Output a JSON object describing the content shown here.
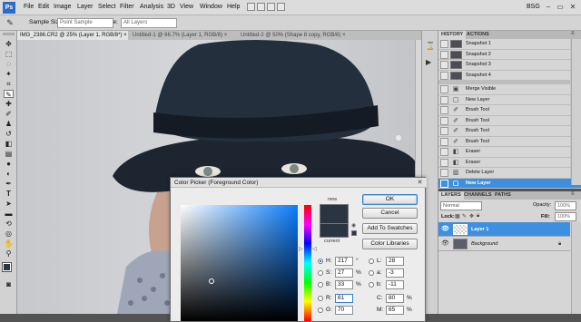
{
  "menubar": {
    "app_logo": "Ps",
    "items": [
      "File",
      "Edit",
      "Image",
      "Layer",
      "Select",
      "Filter",
      "Analysis",
      "3D",
      "View",
      "Window",
      "Help"
    ],
    "workspace": "BSG",
    "win_controls": [
      "–",
      "▭",
      "✕"
    ]
  },
  "options_bar": {
    "sample_size_label": "Sample Size:",
    "sample_size_value": "Point Sample",
    "sample_label": "Sample:",
    "sample_value": "All Layers"
  },
  "doc_tabs": [
    {
      "label": "IMG_2386.CR2 @ 25% (Layer 1, RGB/8*) ×",
      "active": true
    },
    {
      "label": "Untitled-1 @ 66.7% (Layer 1, RGB/8) ×",
      "active": false
    },
    {
      "label": "Untitled-2 @ 50% (Shape 8 copy, RGB/8) ×",
      "active": false
    }
  ],
  "history": {
    "tabs": [
      "HISTORY",
      "ACTIONS"
    ],
    "items": [
      {
        "label": "Snapshot 1",
        "kind": "snapshot"
      },
      {
        "label": "Snapshot 2",
        "kind": "snapshot"
      },
      {
        "label": "Snapshot 3",
        "kind": "snapshot"
      },
      {
        "label": "Snapshot 4",
        "kind": "snapshot"
      },
      {
        "label": "Merge Visible",
        "kind": "step"
      },
      {
        "label": "New Layer",
        "kind": "step"
      },
      {
        "label": "Brush Tool",
        "kind": "step"
      },
      {
        "label": "Brush Tool",
        "kind": "step"
      },
      {
        "label": "Brush Tool",
        "kind": "step"
      },
      {
        "label": "Brush Tool",
        "kind": "step"
      },
      {
        "label": "Eraser",
        "kind": "step"
      },
      {
        "label": "Eraser",
        "kind": "step"
      },
      {
        "label": "Delete Layer",
        "kind": "step"
      },
      {
        "label": "New Layer",
        "kind": "step",
        "selected": true
      }
    ]
  },
  "layers": {
    "tabs": [
      "LAYERS",
      "CHANNELS",
      "PATHS"
    ],
    "blend_mode": "Normal",
    "opacity_label": "Opacity:",
    "opacity_value": "100%",
    "lock_label": "Lock:",
    "fill_label": "Fill:",
    "fill_value": "100%",
    "items": [
      {
        "name": "Layer 1",
        "selected": true
      },
      {
        "name": "Background",
        "selected": false
      }
    ]
  },
  "color_picker": {
    "title": "Color Picker (Foreground Color)",
    "new_label": "new",
    "current_label": "current",
    "new_color": "#2b3542",
    "current_color": "#2b3542",
    "buttons": {
      "ok": "OK",
      "cancel": "Cancel",
      "add_swatches": "Add To Swatches",
      "libraries": "Color Libraries"
    },
    "hsb": {
      "h_label": "H:",
      "h_value": "217",
      "h_unit": "°",
      "s_label": "S:",
      "s_value": "27",
      "s_unit": "%",
      "b_label": "B:",
      "b_value": "33",
      "b_unit": "%"
    },
    "rgb": {
      "r_label": "R:",
      "r_value": "61",
      "g_label": "G:",
      "g_value": "70"
    },
    "lab": {
      "l_label": "L:",
      "l_value": "28",
      "a_label": "a:",
      "a_value": "-3",
      "b_label": "b:",
      "b_value": "-11"
    },
    "cmyk": {
      "c_label": "C:",
      "c_value": "80",
      "c_unit": "%",
      "m_label": "M:",
      "m_value": "65",
      "m_unit": "%"
    }
  },
  "colors": {
    "selection_blue": "#3d8fe0",
    "hat": "#1e2a36"
  }
}
